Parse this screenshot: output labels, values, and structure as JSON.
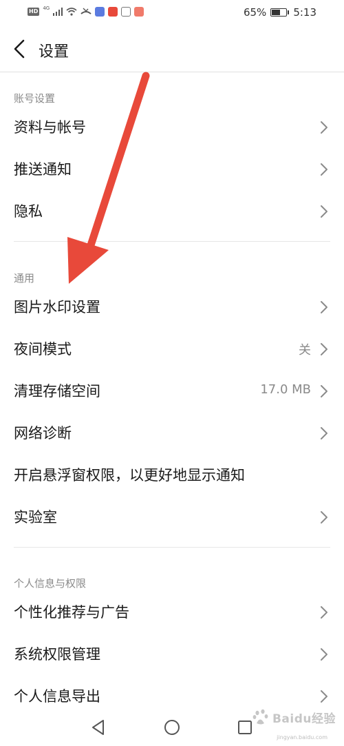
{
  "status_bar": {
    "hd": "HD",
    "network": "4G",
    "battery_percent": "65%",
    "battery_level": 0.65,
    "time": "5:13",
    "icons": [
      "hd-icon",
      "signal-icon",
      "wifi-icon",
      "missed-call-icon",
      "music-icon",
      "app-icon",
      "app-icon",
      "app-icon",
      "battery-icon"
    ]
  },
  "header": {
    "title": "设置"
  },
  "sections": {
    "account": {
      "label": "账号设置",
      "items": {
        "profile": "资料与帐号",
        "push": "推送通知",
        "privacy": "隐私"
      }
    },
    "general": {
      "label": "通用",
      "items": {
        "watermark": "图片水印设置",
        "night_mode": "夜间模式",
        "night_mode_value": "关",
        "storage": "清理存储空间",
        "storage_value": "17.0 MB",
        "network": "网络诊断",
        "float_window": "开启悬浮窗权限，以更好地显示通知",
        "lab": "实验室"
      }
    },
    "personal": {
      "label": "个人信息与权限",
      "items": {
        "ads": "个性化推荐与广告",
        "permissions": "系统权限管理",
        "export": "个人信息导出"
      }
    }
  },
  "watermark": {
    "brand": "Baidu经验",
    "sub": "jingyan.baidu.com"
  },
  "colors": {
    "annotation_arrow": "#e8493a",
    "secondary_text": "#8a8a8a",
    "divider": "#e6e6e6"
  }
}
